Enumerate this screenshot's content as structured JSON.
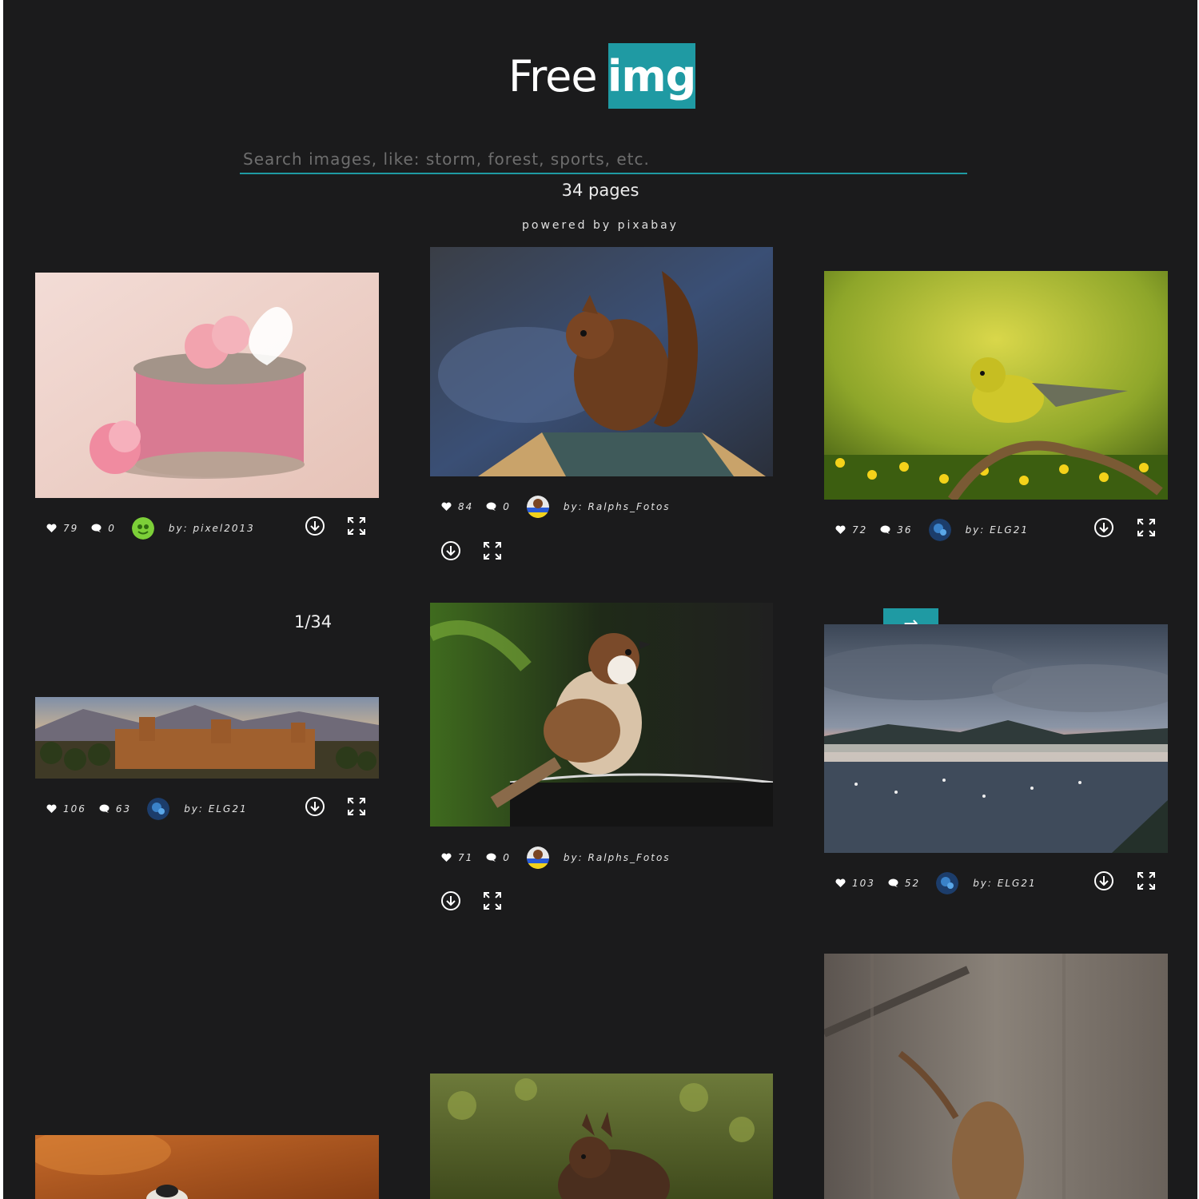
{
  "logo": {
    "word": "Free",
    "badge": "img"
  },
  "search": {
    "placeholder": "Search images, like: storm, forest, sports, etc.",
    "value": ""
  },
  "results": {
    "pages_label": "34 pages",
    "powered_by": "powered by pixabay",
    "page_indicator": "1/34",
    "next_arrow": "→"
  },
  "colors": {
    "accent": "#1f9aa3",
    "background": "#1b1b1c"
  },
  "icons": {
    "likes": "heart-icon",
    "comments": "speech-bubble-icon",
    "download": "download-circle-icon",
    "fullscreen": "expand-arrows-icon",
    "next": "right-arrow-icon"
  },
  "photos": [
    {
      "subject": "pink gift box with carnations",
      "likes": "79",
      "comments": "0",
      "author": "by: pixel2013"
    },
    {
      "subject": "squirrel on birdhouse roof",
      "likes": "84",
      "comments": "0",
      "author": "by: Ralphs_Fotos"
    },
    {
      "subject": "yellow warbler on branch",
      "likes": "72",
      "comments": "36",
      "author": "by: ELG21"
    },
    {
      "subject": "Alhambra panorama at sunset",
      "likes": "106",
      "comments": "63",
      "author": "by: ELG21"
    },
    {
      "subject": "sparrow perched on rim",
      "likes": "71",
      "comments": "0",
      "author": "by: Ralphs_Fotos"
    },
    {
      "subject": "coastal town harbor at dusk",
      "likes": "103",
      "comments": "52",
      "author": "by: ELG21"
    },
    {
      "subject": "dry seed pod against wood",
      "likes": "",
      "comments": "",
      "author": ""
    },
    {
      "subject": "squirrel in grass",
      "likes": "",
      "comments": "",
      "author": ""
    },
    {
      "subject": "small bird on orange background",
      "likes": "",
      "comments": "",
      "author": ""
    }
  ]
}
